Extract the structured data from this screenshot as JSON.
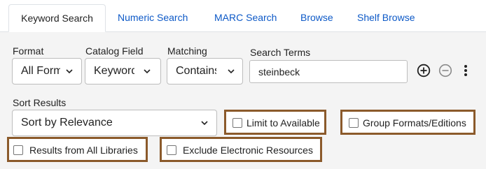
{
  "tabs": [
    {
      "label": "Keyword Search",
      "active": true
    },
    {
      "label": "Numeric Search",
      "active": false
    },
    {
      "label": "MARC Search",
      "active": false
    },
    {
      "label": "Browse",
      "active": false
    },
    {
      "label": "Shelf Browse",
      "active": false
    }
  ],
  "search_row": {
    "format": {
      "label": "Format",
      "value": "All Form"
    },
    "catalog_field": {
      "label": "Catalog Field",
      "value": "Keyword"
    },
    "matching": {
      "label": "Matching",
      "value": "Contains"
    },
    "search_terms": {
      "label": "Search Terms",
      "value": "steinbeck"
    }
  },
  "row_actions": {
    "add": "plus-circle-icon",
    "remove": "minus-circle-icon",
    "more": "vertical-ellipsis-icon"
  },
  "sort": {
    "label": "Sort Results",
    "value": "Sort by Relevance"
  },
  "filters": {
    "limit_available": {
      "label": "Limit to Available",
      "checked": false
    },
    "group_formats": {
      "label": "Group Formats/Editions",
      "checked": false
    },
    "all_libraries": {
      "label": "Results from All Libraries",
      "checked": false
    },
    "exclude_electronic": {
      "label": "Exclude Electronic Resources",
      "checked": false
    }
  },
  "colors": {
    "tab_link": "#0d59c7",
    "highlight_border": "#8b5a2b",
    "panel_bg": "#f4f4f4"
  }
}
